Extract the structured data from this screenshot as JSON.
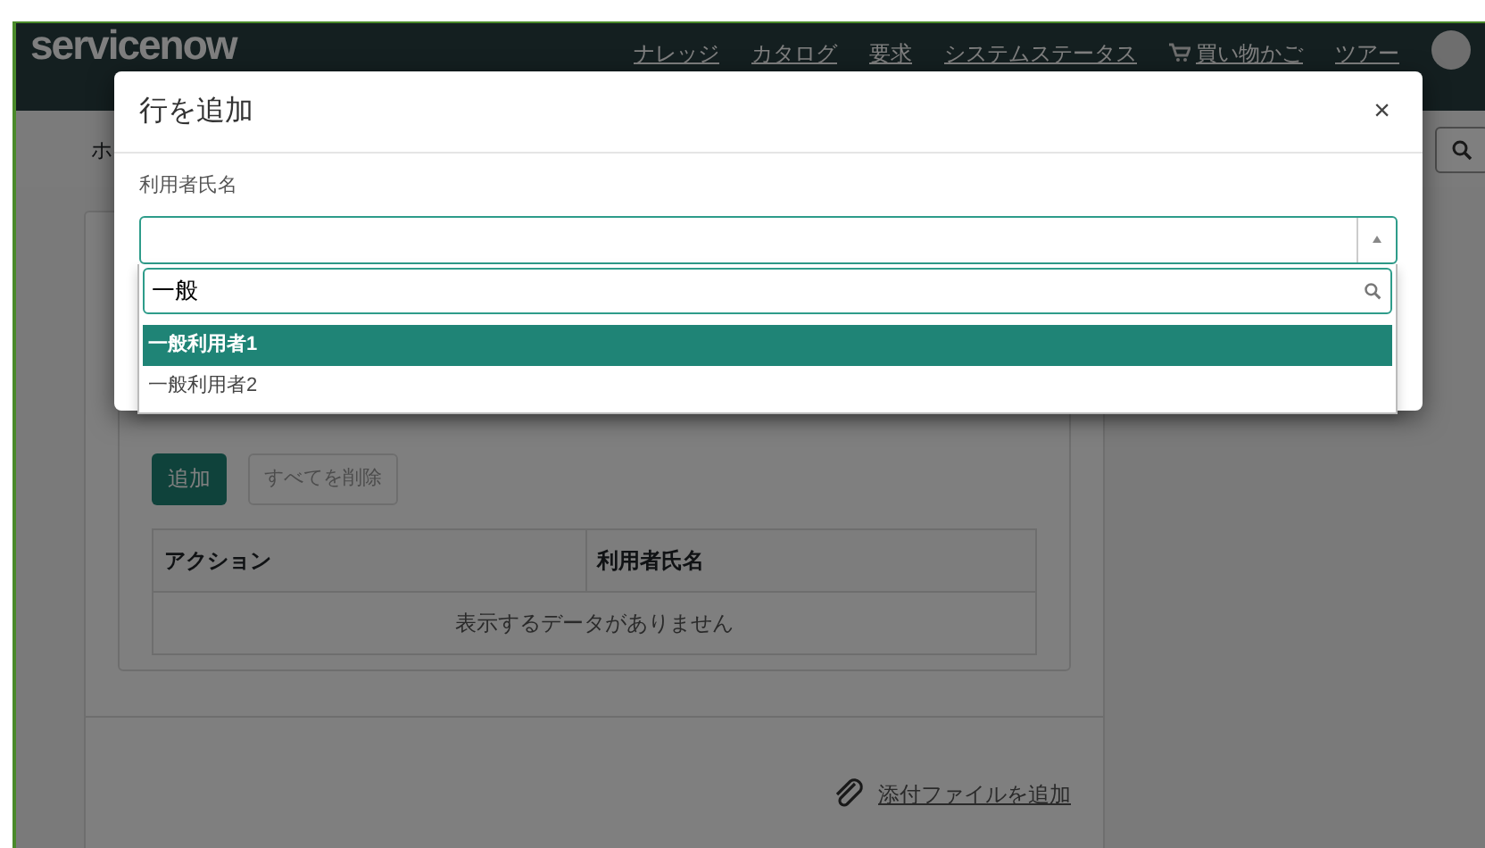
{
  "header": {
    "logo": "servicenow",
    "nav": [
      {
        "label": "ナレッジ"
      },
      {
        "label": "カタログ"
      },
      {
        "label": "要求"
      },
      {
        "label": "システムステータス"
      },
      {
        "label": "買い物かご",
        "kind": "cart"
      },
      {
        "label": "ツアー"
      }
    ]
  },
  "breadcrumb": "ホ",
  "card": {
    "buttons": [
      {
        "label": "追加",
        "disabled": false
      },
      {
        "label": "すべてを削除",
        "disabled": true
      }
    ],
    "table": {
      "columns": [
        "アクション",
        "利用者氏名"
      ],
      "empty_message": "表示するデータがありません"
    },
    "attachment_link": "添付ファイルを追加"
  },
  "modal": {
    "title": "行を追加",
    "close": "×",
    "field_label": "利用者氏名",
    "search_value": "一般",
    "options": [
      {
        "label": "一般利用者1",
        "selected": true
      },
      {
        "label": "一般利用者2",
        "selected": false
      }
    ]
  }
}
